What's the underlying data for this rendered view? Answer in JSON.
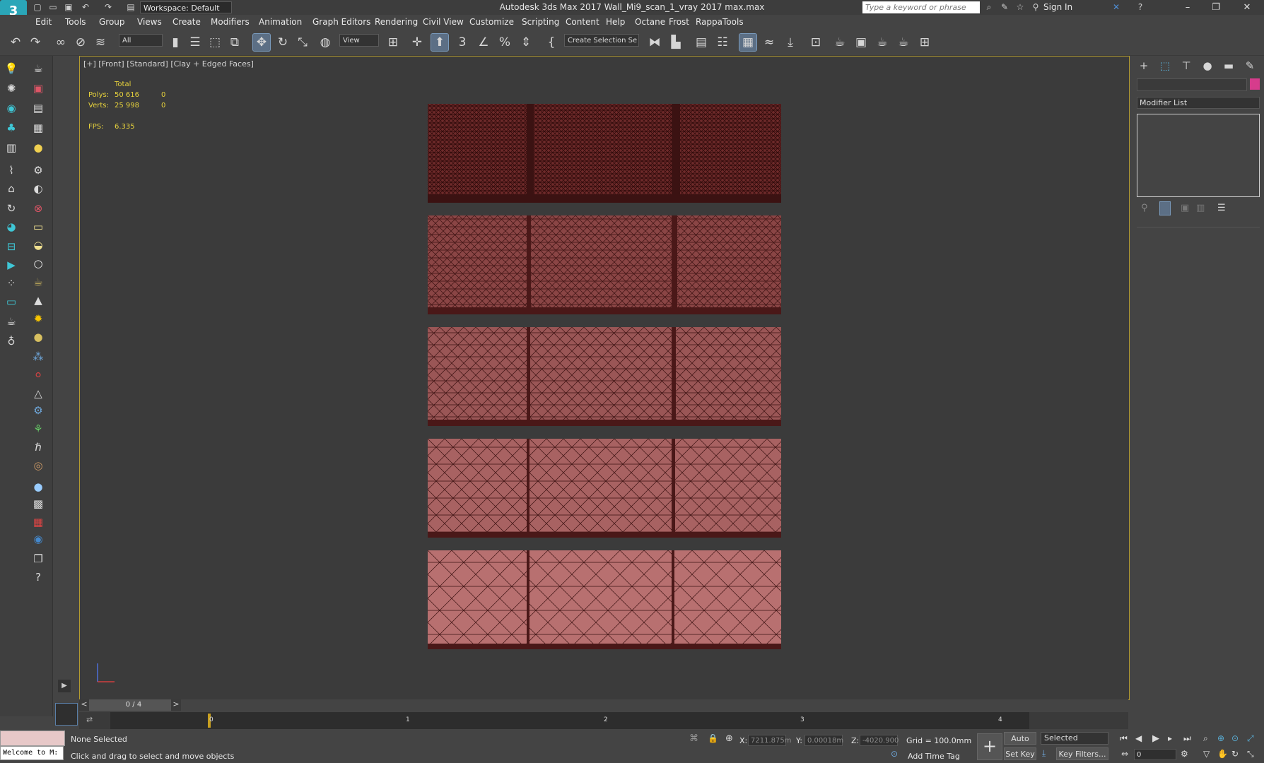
{
  "window": {
    "title": "Autodesk 3ds Max 2017     Wall_Mi9_scan_1_vray 2017 max.max",
    "workspace": "Workspace: Default",
    "search_placeholder": "Type a keyword or phrase",
    "sign_in": "Sign In"
  },
  "menu": [
    "Edit",
    "Tools",
    "Group",
    "Views",
    "Create",
    "Modifiers",
    "Animation",
    "Graph Editors",
    "Rendering",
    "Civil View",
    "Customize",
    "Scripting",
    "Content",
    "Help",
    "Octane",
    "Frost",
    "RappaTools"
  ],
  "toolbar": {
    "filter": "All",
    "ref_coord": "View",
    "selection_set": "Create Selection Se"
  },
  "viewport": {
    "label": "[+] [Front] [Standard] [Clay + Edged Faces]",
    "stats": {
      "total_label": "Total",
      "polys_label": "Polys:",
      "polys_value": "50 616",
      "polys_sel": "0",
      "verts_label": "Verts:",
      "verts_value": "25 998",
      "verts_sel": "0",
      "fps_label": "FPS:",
      "fps_value": "6.335"
    },
    "meshes": [
      {
        "density": "very high"
      },
      {
        "density": "high"
      },
      {
        "density": "medium"
      },
      {
        "density": "low"
      },
      {
        "density": "very low"
      }
    ]
  },
  "right_panel": {
    "modifier_list": "Modifier List"
  },
  "timeline": {
    "frame": "0 / 4",
    "ticks": [
      "0",
      "1",
      "2",
      "3",
      "4"
    ]
  },
  "status": {
    "maxscript": "Welcome to M:",
    "selection": "None Selected",
    "prompt": "Click and drag to select and move objects",
    "x_label": "X:",
    "x_value": "7211.875m",
    "y_label": "Y:",
    "y_value": "0.00018m",
    "z_label": "Z:",
    "z_value": "-4020.900",
    "grid": "Grid = 100.0mm",
    "add_time_tag": "Add Time Tag",
    "auto_key": "Auto Key",
    "set_key": "Set Key",
    "selected": "Selected",
    "key_filters": "Key Filters...",
    "frame_field": "0"
  },
  "colors": {
    "viewport_bg": "#3b3b3b",
    "viewport_border": "#b39b30",
    "mesh_fill": "#b86d6d",
    "mesh_wire": "#3a1010",
    "stat_text": "#e8d33c",
    "accent": "#5c9be0"
  }
}
